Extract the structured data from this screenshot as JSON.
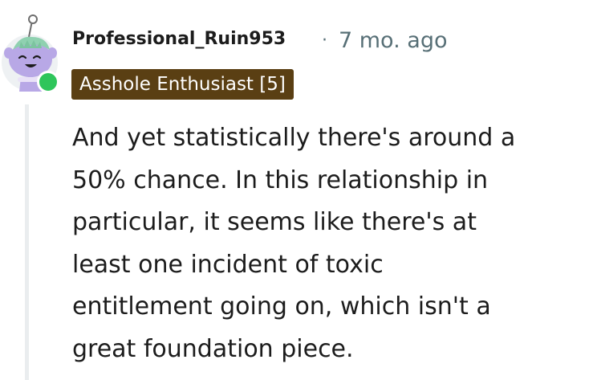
{
  "comment": {
    "author": "Professional_Ruin953",
    "separator": "·",
    "timestamp": "7 mo. ago",
    "flair": "Asshole Enthusiast [5]",
    "online": true,
    "body_lines": [
      "And yet statistically there's around a",
      "50% chance. In this relationship in",
      "particular, it seems like there's at",
      "least one incident of toxic",
      "entitlement going on, which isn't a",
      "great foundation piece."
    ]
  },
  "colors": {
    "flair_bg": "#5a3f13",
    "flair_text": "#ffffff",
    "online_indicator": "#2ec55b",
    "avatar_body": "#b8a8e6",
    "avatar_hair": "#8fd1b0",
    "meta_text": "#576f76",
    "body_text": "#1c1c1c",
    "thread_line": "#eaedef"
  },
  "icons": {
    "avatar": "snoo-avatar-icon",
    "online": "online-status-icon"
  }
}
